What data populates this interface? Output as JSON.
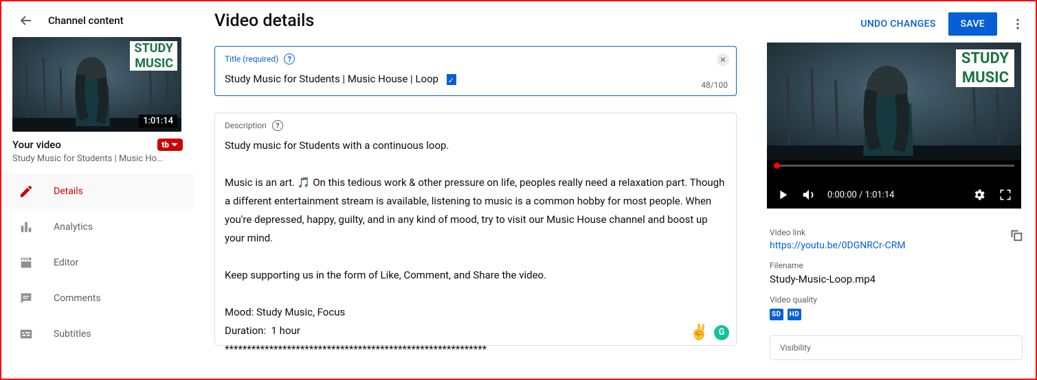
{
  "header": {
    "back_label": "Channel content",
    "page_title": "Video details",
    "undo": "UNDO CHANGES",
    "save": "SAVE"
  },
  "sidebar": {
    "duration": "1:01:14",
    "badge_line1": "STUDY",
    "badge_line2": "MUSIC",
    "your_video": "Your video",
    "video_title_trunc": "Study Music for Students | Music Ho…",
    "tubebuddy": "tb",
    "nav": [
      {
        "label": "Details",
        "icon": "pencil"
      },
      {
        "label": "Analytics",
        "icon": "bars"
      },
      {
        "label": "Editor",
        "icon": "clapper"
      },
      {
        "label": "Comments",
        "icon": "comment"
      },
      {
        "label": "Subtitles",
        "icon": "subtitles"
      }
    ]
  },
  "title_field": {
    "label": "Title (required)",
    "value": "Study Music for Students | Music House | Loop",
    "counter": "48/100"
  },
  "description_field": {
    "label": "Description",
    "value": "Study music for Students with a continuous loop.\n\nMusic is an art. 🎵 On this tedious work & other pressure on life, peoples really need a relaxation part. Though a different entertainment stream is available, listening to music is a common hobby for most people. When you're depressed, happy, guilty, and in any kind of mood, try to visit our Music House channel and boost up your mind.\n\nKeep supporting us in the form of Like, Comment, and Share the video.\n\nMood: Study Music, Focus\nDuration:  1 hour\n***********************************************************"
  },
  "preview": {
    "time": "0:00:00 / 1:01:14",
    "badge_line1": "STUDY",
    "badge_line2": "MUSIC",
    "video_link_label": "Video link",
    "video_link": "https://youtu.be/0DGNRCr-CRM",
    "filename_label": "Filename",
    "filename": "Study-Music-Loop.mp4",
    "quality_label": "Video quality",
    "quality": [
      "SD",
      "HD"
    ],
    "visibility_label": "Visibility"
  }
}
